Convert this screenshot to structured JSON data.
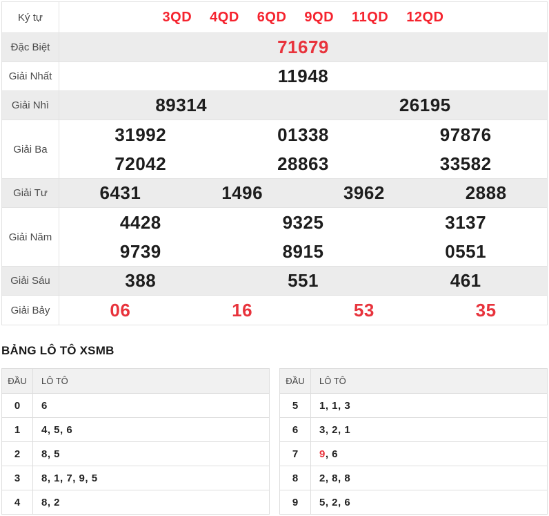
{
  "colors": {
    "accent_red": "#e8333c",
    "kytu_red": "#f5232e",
    "row_gray": "#ececec",
    "border": "#e2e2e2"
  },
  "prize_table": {
    "rows": [
      {
        "label": "Ký tự",
        "values": [
          "3QD",
          "4QD",
          "6QD",
          "9QD",
          "11QD",
          "12QD"
        ]
      },
      {
        "label": "Đặc Biệt",
        "values": [
          "71679"
        ]
      },
      {
        "label": "Giải Nhất",
        "values": [
          "11948"
        ]
      },
      {
        "label": "Giải Nhì",
        "values": [
          "89314",
          "26195"
        ]
      },
      {
        "label": "Giải Ba",
        "lines": [
          [
            "31992",
            "01338",
            "97876"
          ],
          [
            "72042",
            "28863",
            "33582"
          ]
        ]
      },
      {
        "label": "Giải Tư",
        "values": [
          "6431",
          "1496",
          "3962",
          "2888"
        ]
      },
      {
        "label": "Giải Năm",
        "lines": [
          [
            "4428",
            "9325",
            "3137"
          ],
          [
            "9739",
            "8915",
            "0551"
          ]
        ]
      },
      {
        "label": "Giải Sáu",
        "values": [
          "388",
          "551",
          "461"
        ]
      },
      {
        "label": "Giải Bảy",
        "values": [
          "06",
          "16",
          "53",
          "35"
        ]
      }
    ]
  },
  "loto_section": {
    "title": "BẢNG LÔ TÔ XSMB",
    "col_headers": {
      "dau": "ĐẦU",
      "loto": "LÔ TÔ"
    },
    "left_rows": [
      {
        "dau": "0",
        "lo_red": "",
        "lo": "6"
      },
      {
        "dau": "1",
        "lo_red": "",
        "lo": "4, 5, 6"
      },
      {
        "dau": "2",
        "lo_red": "",
        "lo": "8, 5"
      },
      {
        "dau": "3",
        "lo_red": "",
        "lo": "8, 1, 7, 9, 5"
      },
      {
        "dau": "4",
        "lo_red": "",
        "lo": "8, 2"
      }
    ],
    "right_rows": [
      {
        "dau": "5",
        "lo_red": "",
        "lo": "1, 1, 3"
      },
      {
        "dau": "6",
        "lo_red": "",
        "lo": "3, 2, 1"
      },
      {
        "dau": "7",
        "lo_red": "9",
        "lo": ", 6"
      },
      {
        "dau": "8",
        "lo_red": "",
        "lo": "2, 8, 8"
      },
      {
        "dau": "9",
        "lo_red": "",
        "lo": "5, 2, 6"
      }
    ]
  }
}
